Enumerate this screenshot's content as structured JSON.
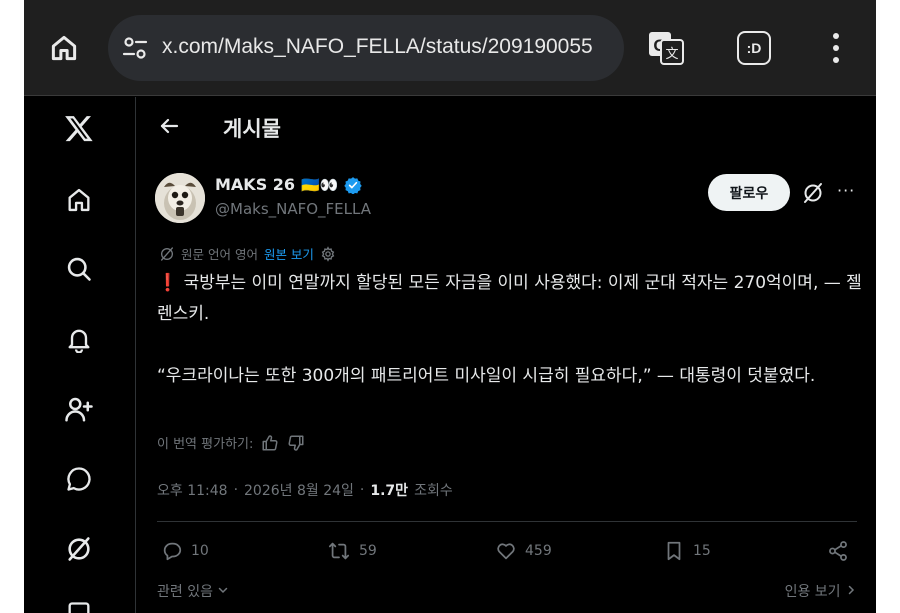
{
  "browser": {
    "url": "x.com/Maks_NAFO_FELLA/status/209190055",
    "tabs_label": ":D"
  },
  "post_header": {
    "title": "게시물"
  },
  "author": {
    "display_name": "MAKS 26",
    "name_emoji": "🇺🇦👀",
    "handle": "@Maks_NAFO_FELLA",
    "verified": true
  },
  "follow_label": "팔로우",
  "more_label": "···",
  "translation": {
    "label": "원문 언어 영어",
    "show_original": "원본 보기"
  },
  "tweet": {
    "paragraph1": "❗ 국방부는 이미 연말까지 할당된 모든 자금을 이미 사용했다: 이제 군대 적자는 270억이며, — 젤렌스키.",
    "paragraph2": "“우크라이나는 또한 300개의 패트리어트 미사일이 시급히 필요하다,” — 대통령이 덧붙였다."
  },
  "rate_translation": "이 번역 평가하기:",
  "meta": {
    "time": "오후 11:48",
    "sep1": "·",
    "date": "2026년 8월 24일",
    "sep2": "·",
    "views": "1.7만",
    "views_label": "조회수"
  },
  "actions": {
    "replies": "10",
    "reposts": "59",
    "likes": "459",
    "bookmarks": "15"
  },
  "footer": {
    "related": "관련 있음",
    "quotes": "인용 보기"
  },
  "colors": {
    "background": "#000000",
    "text": "#e7e9ea",
    "secondary": "#71767b",
    "link": "#1d9bf0",
    "verified": "#1d9bf0",
    "browser_bar": "#1f1f1f"
  }
}
